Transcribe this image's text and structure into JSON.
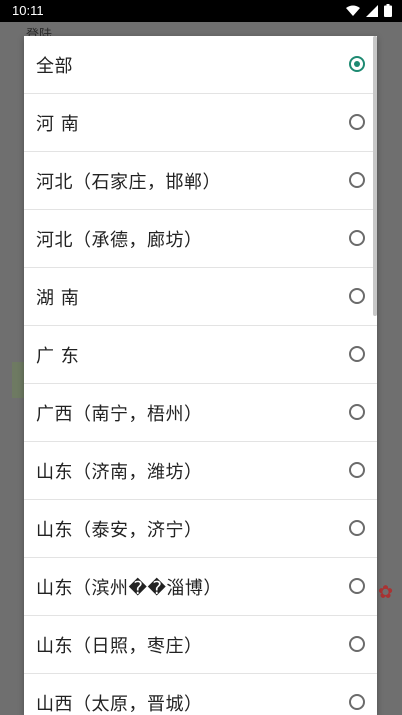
{
  "status_bar": {
    "time": "10:11"
  },
  "background": {
    "title": "登陆"
  },
  "dialog": {
    "items": [
      {
        "label": "全部",
        "checked": true
      },
      {
        "label": "河 南",
        "checked": false
      },
      {
        "label": "河北（石家庄，邯郸）",
        "checked": false
      },
      {
        "label": "河北（承德，廊坊）",
        "checked": false
      },
      {
        "label": "湖 南",
        "checked": false
      },
      {
        "label": "广 东",
        "checked": false
      },
      {
        "label": "广西（南宁，梧州）",
        "checked": false
      },
      {
        "label": "山东（济南，潍坊）",
        "checked": false
      },
      {
        "label": "山东（泰安，济宁）",
        "checked": false
      },
      {
        "label": "山东（滨州��淄博）",
        "checked": false
      },
      {
        "label": "山东（日照，枣庄）",
        "checked": false
      },
      {
        "label": "山西（太原，晋城）",
        "checked": false
      }
    ]
  }
}
